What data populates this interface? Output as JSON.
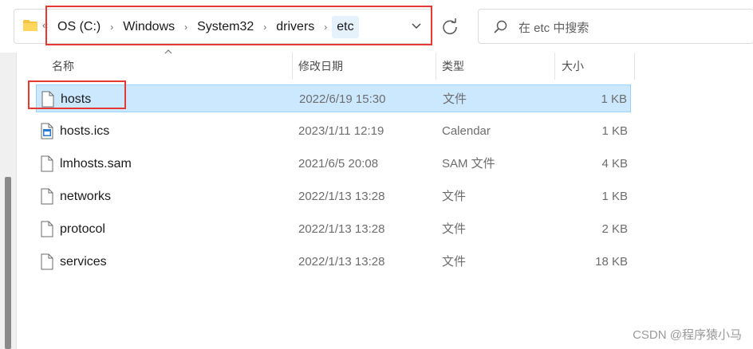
{
  "address_bar": {
    "crumbs": [
      {
        "label": "OS (C:)"
      },
      {
        "label": "Windows"
      },
      {
        "label": "System32"
      },
      {
        "label": "drivers"
      },
      {
        "label": "etc"
      }
    ]
  },
  "search": {
    "placeholder": "在 etc 中搜索"
  },
  "columns": {
    "name": "名称",
    "date": "修改日期",
    "type": "类型",
    "size": "大小"
  },
  "files": [
    {
      "name": "hosts",
      "date": "2022/6/19 15:30",
      "type": "文件",
      "size": "1 KB",
      "icon": "file-icon",
      "selected": true
    },
    {
      "name": "hosts.ics",
      "date": "2023/1/11 12:19",
      "type": "Calendar",
      "size": "1 KB",
      "icon": "calendar-file-icon",
      "selected": false
    },
    {
      "name": "lmhosts.sam",
      "date": "2021/6/5 20:08",
      "type": "SAM 文件",
      "size": "4 KB",
      "icon": "file-icon",
      "selected": false
    },
    {
      "name": "networks",
      "date": "2022/1/13 13:28",
      "type": "文件",
      "size": "1 KB",
      "icon": "file-icon",
      "selected": false
    },
    {
      "name": "protocol",
      "date": "2022/1/13 13:28",
      "type": "文件",
      "size": "2 KB",
      "icon": "file-icon",
      "selected": false
    },
    {
      "name": "services",
      "date": "2022/1/13 13:28",
      "type": "文件",
      "size": "18 KB",
      "icon": "file-icon",
      "selected": false
    }
  ],
  "watermark": "CSDN @程序猿小马",
  "colors": {
    "selection": "#cce8ff",
    "annotation": "#e53935",
    "folder": "#f4c542"
  }
}
